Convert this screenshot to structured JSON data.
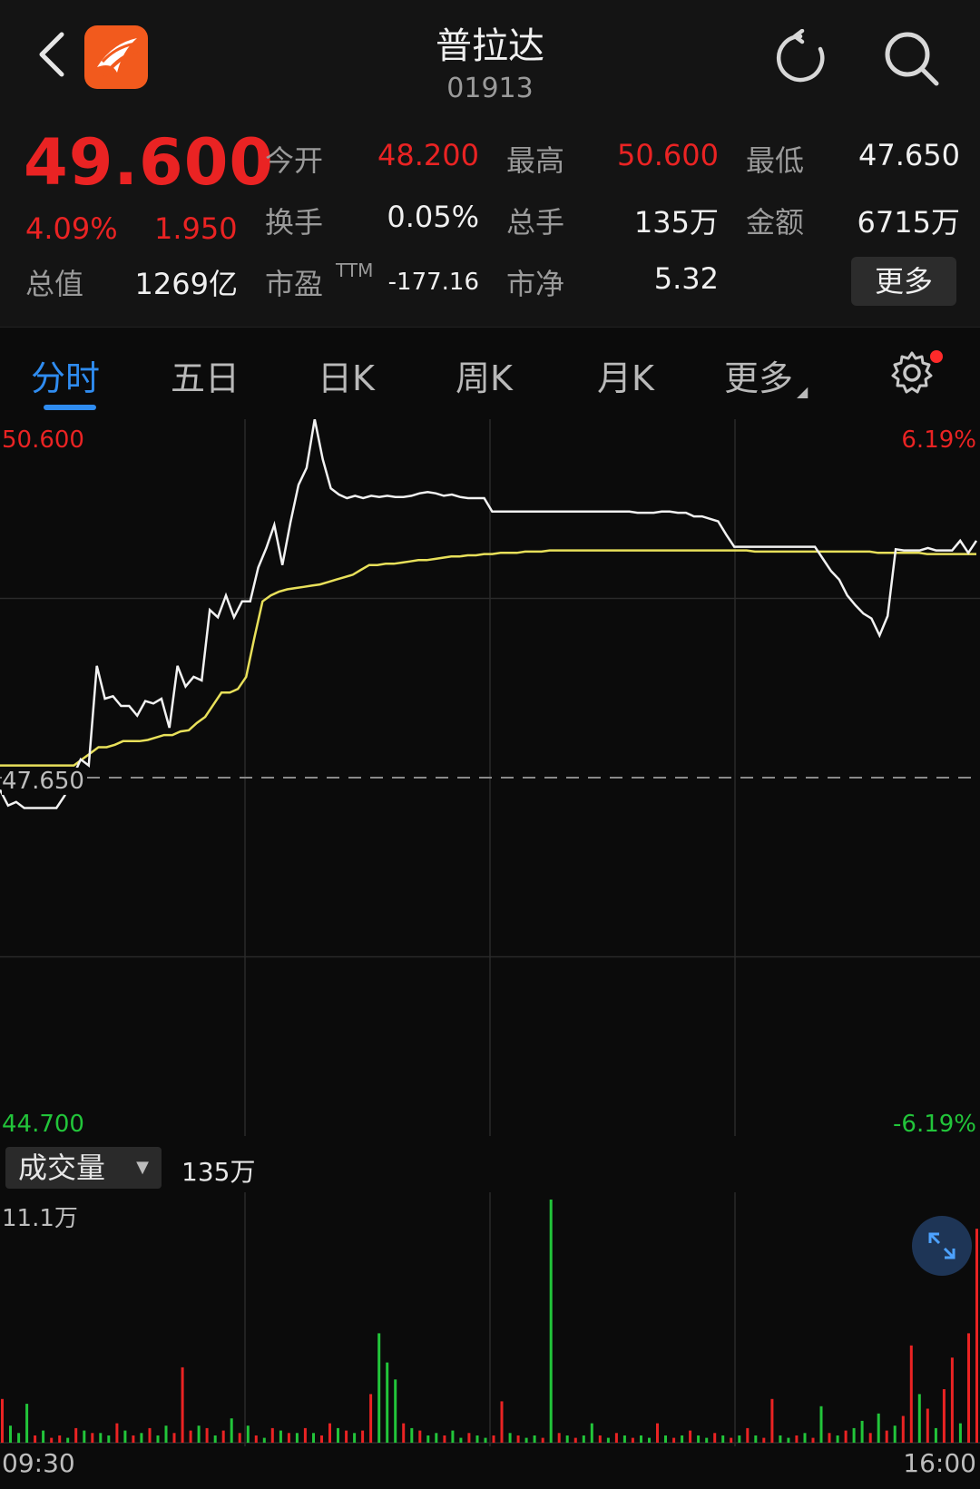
{
  "header": {
    "title": "普拉达",
    "code": "01913"
  },
  "quote": {
    "price": "49.600",
    "change_pct": "4.09%",
    "change": "1.950",
    "fields": [
      {
        "label": "今开",
        "value": "48.200",
        "color": "#ea2323"
      },
      {
        "label": "最高",
        "value": "50.600",
        "color": "#ea2323"
      },
      {
        "label": "最低",
        "value": "47.650",
        "color": "#f0f0f0"
      },
      {
        "label": "换手",
        "value": "0.05%",
        "color": "#f0f0f0"
      },
      {
        "label": "总手",
        "value": "135万",
        "color": "#f0f0f0"
      },
      {
        "label": "金额",
        "value": "6715万",
        "color": "#f0f0f0"
      },
      {
        "label": "总值",
        "value": "1269亿",
        "color": "#f0f0f0"
      },
      {
        "label": "市盈",
        "label_sup": "TTM",
        "value": "-177.16",
        "color": "#f0f0f0"
      },
      {
        "label": "市净",
        "value": "5.32",
        "color": "#f0f0f0"
      }
    ],
    "more_label": "更多"
  },
  "tabs": [
    "分时",
    "五日",
    "日K",
    "周K",
    "月K",
    "更多"
  ],
  "active_tab": 0,
  "chart_data": {
    "type": "line",
    "y_max": "50.600",
    "y_min": "44.700",
    "y_ref": "47.650",
    "pct_max": "6.19%",
    "pct_min": "-6.19%",
    "price_series": [
      47.55,
      47.42,
      47.45,
      47.4,
      47.4,
      47.4,
      47.4,
      47.4,
      47.5,
      47.65,
      47.8,
      47.75,
      48.57,
      48.3,
      48.32,
      48.24,
      48.24,
      48.16,
      48.28,
      48.26,
      48.3,
      48.06,
      48.57,
      48.4,
      48.48,
      48.45,
      49.03,
      48.97,
      49.15,
      48.97,
      49.1,
      49.1,
      49.38,
      49.54,
      49.73,
      49.4,
      49.75,
      50.06,
      50.2,
      50.6,
      50.27,
      50.03,
      49.98,
      49.95,
      49.97,
      49.95,
      49.97,
      49.96,
      49.97,
      49.96,
      49.96,
      49.97,
      49.99,
      50.0,
      49.99,
      49.97,
      49.98,
      49.96,
      49.95,
      49.95,
      49.95,
      49.84,
      49.84,
      49.84,
      49.84,
      49.84,
      49.84,
      49.84,
      49.84,
      49.84,
      49.84,
      49.84,
      49.84,
      49.84,
      49.84,
      49.84,
      49.84,
      49.84,
      49.84,
      49.83,
      49.83,
      49.83,
      49.84,
      49.84,
      49.83,
      49.83,
      49.8,
      49.8,
      49.78,
      49.76,
      49.65,
      49.55,
      49.55,
      49.55,
      49.55,
      49.55,
      49.55,
      49.55,
      49.55,
      49.55,
      49.55,
      49.55,
      49.45,
      49.35,
      49.28,
      49.15,
      49.07,
      49.0,
      48.96,
      48.82,
      48.98,
      49.53,
      49.52,
      49.52,
      49.52,
      49.54,
      49.52,
      49.52,
      49.52,
      49.6,
      49.5,
      49.6
    ],
    "avg_series": [
      47.75,
      47.75,
      47.75,
      47.75,
      47.75,
      47.75,
      47.75,
      47.75,
      47.75,
      47.75,
      47.8,
      47.85,
      47.9,
      47.9,
      47.92,
      47.95,
      47.95,
      47.95,
      47.96,
      47.98,
      48.0,
      48.0,
      48.03,
      48.04,
      48.1,
      48.15,
      48.25,
      48.35,
      48.35,
      48.38,
      48.48,
      48.8,
      49.1,
      49.15,
      49.18,
      49.2,
      49.21,
      49.22,
      49.23,
      49.24,
      49.26,
      49.28,
      49.3,
      49.32,
      49.36,
      49.4,
      49.4,
      49.41,
      49.41,
      49.42,
      49.43,
      49.44,
      49.44,
      49.45,
      49.46,
      49.47,
      49.47,
      49.48,
      49.48,
      49.49,
      49.49,
      49.5,
      49.5,
      49.5,
      49.51,
      49.51,
      49.51,
      49.52,
      49.52,
      49.52,
      49.52,
      49.52,
      49.52,
      49.52,
      49.52,
      49.52,
      49.52,
      49.52,
      49.52,
      49.52,
      49.52,
      49.52,
      49.52,
      49.52,
      49.52,
      49.52,
      49.52,
      49.52,
      49.52,
      49.52,
      49.52,
      49.52,
      49.51,
      49.51,
      49.51,
      49.51,
      49.51,
      49.51,
      49.51,
      49.51,
      49.51,
      49.51,
      49.51,
      49.51,
      49.51,
      49.51,
      49.51,
      49.5,
      49.5,
      49.5,
      49.5,
      49.5,
      49.5,
      49.49,
      49.49,
      49.49,
      49.49,
      49.49,
      49.49,
      49.49
    ],
    "x_start": "09:30",
    "x_end": "16:00"
  },
  "volume": {
    "label": "成交量",
    "total": "135万",
    "max_label": "11.1万",
    "bars": [
      {
        "v": 0.18,
        "c": "r"
      },
      {
        "v": 0.07,
        "c": "g"
      },
      {
        "v": 0.04,
        "c": "g"
      },
      {
        "v": 0.16,
        "c": "g"
      },
      {
        "v": 0.03,
        "c": "r"
      },
      {
        "v": 0.05,
        "c": "g"
      },
      {
        "v": 0.02,
        "c": "r"
      },
      {
        "v": 0.03,
        "c": "r"
      },
      {
        "v": 0.02,
        "c": "g"
      },
      {
        "v": 0.06,
        "c": "r"
      },
      {
        "v": 0.05,
        "c": "g"
      },
      {
        "v": 0.04,
        "c": "r"
      },
      {
        "v": 0.04,
        "c": "g"
      },
      {
        "v": 0.03,
        "c": "g"
      },
      {
        "v": 0.08,
        "c": "r"
      },
      {
        "v": 0.05,
        "c": "g"
      },
      {
        "v": 0.03,
        "c": "r"
      },
      {
        "v": 0.04,
        "c": "g"
      },
      {
        "v": 0.06,
        "c": "r"
      },
      {
        "v": 0.03,
        "c": "g"
      },
      {
        "v": 0.07,
        "c": "g"
      },
      {
        "v": 0.04,
        "c": "r"
      },
      {
        "v": 0.31,
        "c": "r"
      },
      {
        "v": 0.05,
        "c": "r"
      },
      {
        "v": 0.07,
        "c": "g"
      },
      {
        "v": 0.06,
        "c": "r"
      },
      {
        "v": 0.03,
        "c": "g"
      },
      {
        "v": 0.05,
        "c": "r"
      },
      {
        "v": 0.1,
        "c": "g"
      },
      {
        "v": 0.04,
        "c": "r"
      },
      {
        "v": 0.07,
        "c": "g"
      },
      {
        "v": 0.03,
        "c": "r"
      },
      {
        "v": 0.02,
        "c": "g"
      },
      {
        "v": 0.06,
        "c": "r"
      },
      {
        "v": 0.05,
        "c": "g"
      },
      {
        "v": 0.04,
        "c": "r"
      },
      {
        "v": 0.04,
        "c": "g"
      },
      {
        "v": 0.06,
        "c": "r"
      },
      {
        "v": 0.04,
        "c": "g"
      },
      {
        "v": 0.03,
        "c": "r"
      },
      {
        "v": 0.08,
        "c": "r"
      },
      {
        "v": 0.06,
        "c": "g"
      },
      {
        "v": 0.05,
        "c": "r"
      },
      {
        "v": 0.04,
        "c": "g"
      },
      {
        "v": 0.05,
        "c": "r"
      },
      {
        "v": 0.2,
        "c": "r"
      },
      {
        "v": 0.45,
        "c": "g"
      },
      {
        "v": 0.33,
        "c": "g"
      },
      {
        "v": 0.26,
        "c": "g"
      },
      {
        "v": 0.08,
        "c": "r"
      },
      {
        "v": 0.06,
        "c": "g"
      },
      {
        "v": 0.05,
        "c": "r"
      },
      {
        "v": 0.03,
        "c": "g"
      },
      {
        "v": 0.04,
        "c": "g"
      },
      {
        "v": 0.03,
        "c": "r"
      },
      {
        "v": 0.05,
        "c": "g"
      },
      {
        "v": 0.02,
        "c": "g"
      },
      {
        "v": 0.04,
        "c": "r"
      },
      {
        "v": 0.03,
        "c": "g"
      },
      {
        "v": 0.02,
        "c": "g"
      },
      {
        "v": 0.03,
        "c": "r"
      },
      {
        "v": 0.17,
        "c": "r"
      },
      {
        "v": 0.04,
        "c": "g"
      },
      {
        "v": 0.03,
        "c": "r"
      },
      {
        "v": 0.02,
        "c": "g"
      },
      {
        "v": 0.03,
        "c": "g"
      },
      {
        "v": 0.02,
        "c": "r"
      },
      {
        "v": 1.0,
        "c": "g"
      },
      {
        "v": 0.04,
        "c": "r"
      },
      {
        "v": 0.03,
        "c": "g"
      },
      {
        "v": 0.02,
        "c": "r"
      },
      {
        "v": 0.03,
        "c": "g"
      },
      {
        "v": 0.08,
        "c": "g"
      },
      {
        "v": 0.03,
        "c": "r"
      },
      {
        "v": 0.02,
        "c": "g"
      },
      {
        "v": 0.04,
        "c": "r"
      },
      {
        "v": 0.03,
        "c": "g"
      },
      {
        "v": 0.02,
        "c": "r"
      },
      {
        "v": 0.03,
        "c": "g"
      },
      {
        "v": 0.02,
        "c": "g"
      },
      {
        "v": 0.08,
        "c": "r"
      },
      {
        "v": 0.03,
        "c": "g"
      },
      {
        "v": 0.02,
        "c": "r"
      },
      {
        "v": 0.03,
        "c": "g"
      },
      {
        "v": 0.05,
        "c": "r"
      },
      {
        "v": 0.03,
        "c": "g"
      },
      {
        "v": 0.02,
        "c": "g"
      },
      {
        "v": 0.04,
        "c": "r"
      },
      {
        "v": 0.03,
        "c": "g"
      },
      {
        "v": 0.02,
        "c": "r"
      },
      {
        "v": 0.03,
        "c": "g"
      },
      {
        "v": 0.06,
        "c": "r"
      },
      {
        "v": 0.03,
        "c": "g"
      },
      {
        "v": 0.02,
        "c": "r"
      },
      {
        "v": 0.18,
        "c": "r"
      },
      {
        "v": 0.03,
        "c": "g"
      },
      {
        "v": 0.02,
        "c": "g"
      },
      {
        "v": 0.03,
        "c": "r"
      },
      {
        "v": 0.04,
        "c": "g"
      },
      {
        "v": 0.02,
        "c": "r"
      },
      {
        "v": 0.15,
        "c": "g"
      },
      {
        "v": 0.04,
        "c": "r"
      },
      {
        "v": 0.03,
        "c": "g"
      },
      {
        "v": 0.05,
        "c": "r"
      },
      {
        "v": 0.06,
        "c": "g"
      },
      {
        "v": 0.09,
        "c": "g"
      },
      {
        "v": 0.04,
        "c": "r"
      },
      {
        "v": 0.12,
        "c": "g"
      },
      {
        "v": 0.05,
        "c": "r"
      },
      {
        "v": 0.07,
        "c": "g"
      },
      {
        "v": 0.11,
        "c": "r"
      },
      {
        "v": 0.4,
        "c": "r"
      },
      {
        "v": 0.2,
        "c": "g"
      },
      {
        "v": 0.14,
        "c": "r"
      },
      {
        "v": 0.06,
        "c": "g"
      },
      {
        "v": 0.22,
        "c": "r"
      },
      {
        "v": 0.35,
        "c": "r"
      },
      {
        "v": 0.08,
        "c": "g"
      },
      {
        "v": 0.45,
        "c": "r"
      },
      {
        "v": 0.88,
        "c": "r"
      }
    ],
    "colors": {
      "up": "#ea2323",
      "down": "#22c53a"
    }
  },
  "colors": {
    "price_line": "#f2f2f2",
    "avg_line": "#e8e05a",
    "grid": "#2a2a2a"
  }
}
